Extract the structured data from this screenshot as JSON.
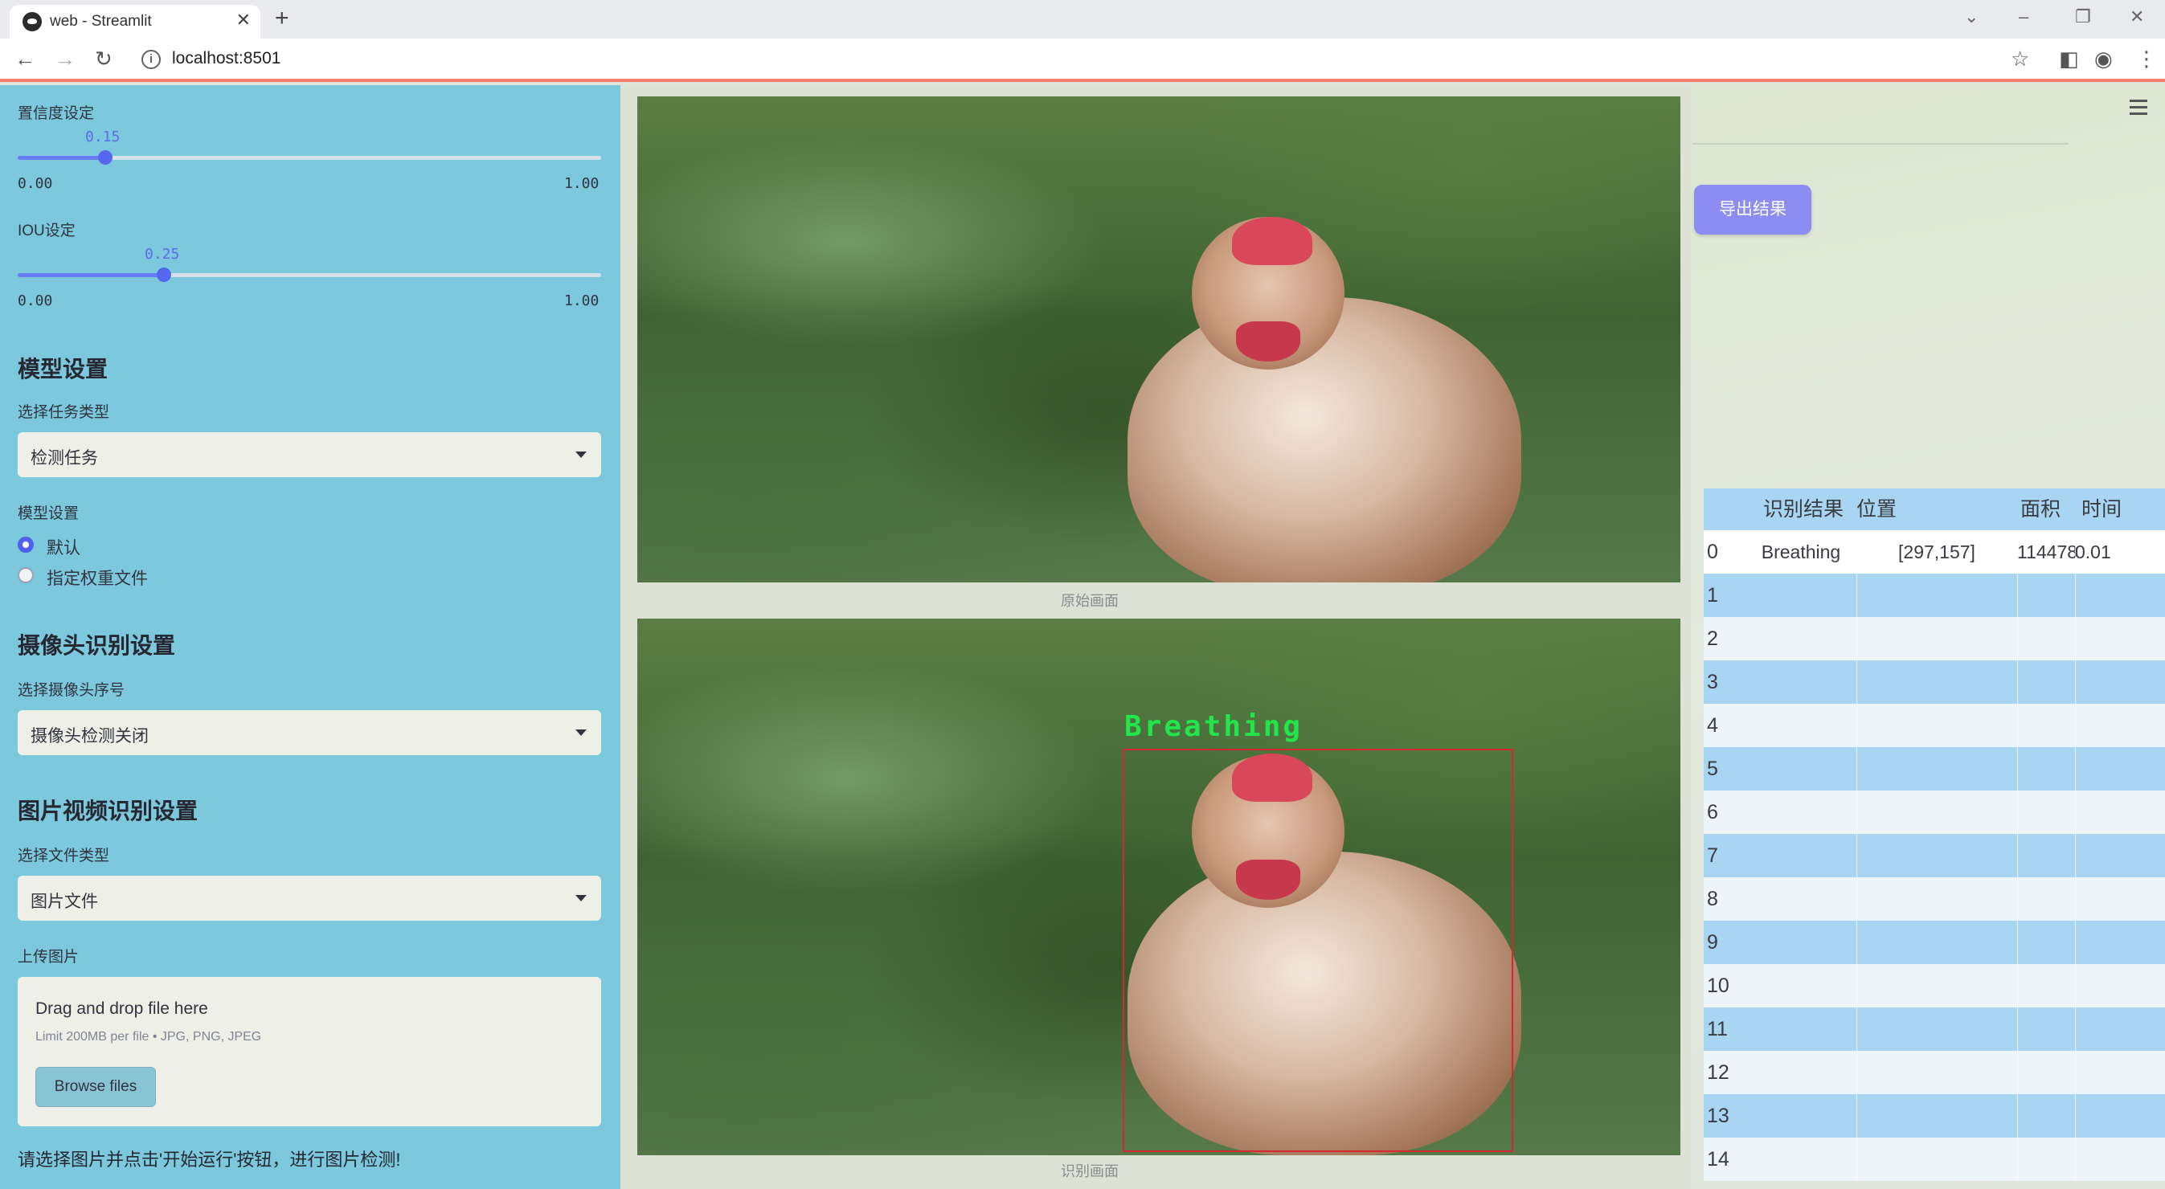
{
  "browser": {
    "tab_title": "web - Streamlit",
    "url": "localhost:8501"
  },
  "sidebar": {
    "conf_label": "置信度设定",
    "conf_value": 0.15,
    "conf_value_text": "0.15",
    "conf_min": "0.00",
    "conf_max": "1.00",
    "iou_label": "IOU设定",
    "iou_value": 0.25,
    "iou_value_text": "0.25",
    "iou_min": "0.00",
    "iou_max": "1.00",
    "model_header": "模型设置",
    "task_label": "选择任务类型",
    "task_value": "检测任务",
    "model_label": "模型设置",
    "model_options": [
      "默认",
      "指定权重文件"
    ],
    "model_selected": 0,
    "camera_header": "摄像头识别设置",
    "camera_label": "选择摄像头序号",
    "camera_value": "摄像头检测关闭",
    "media_header": "图片视频识别设置",
    "filetype_label": "选择文件类型",
    "filetype_value": "图片文件",
    "upload_label": "上传图片",
    "upload_drop": "Drag and drop file here",
    "upload_limit": "Limit 200MB per file • JPG, PNG, JPEG",
    "browse_button": "Browse files",
    "hint": "请选择图片并点击'开始运行'按钮，进行图片检测!"
  },
  "main": {
    "original_caption": "原始画面",
    "result_caption": "识别画面",
    "detection_label": "Breathing",
    "export_button": "导出结果"
  },
  "table": {
    "headers": [
      "",
      "识别结果",
      "位置",
      "面积",
      "时间"
    ],
    "rows": [
      [
        "0",
        "Breathing",
        "[297,157]",
        "114478",
        "0.01"
      ],
      [
        "1",
        "",
        "",
        "",
        ""
      ],
      [
        "2",
        "",
        "",
        "",
        ""
      ],
      [
        "3",
        "",
        "",
        "",
        ""
      ],
      [
        "4",
        "",
        "",
        "",
        ""
      ],
      [
        "5",
        "",
        "",
        "",
        ""
      ],
      [
        "6",
        "",
        "",
        "",
        ""
      ],
      [
        "7",
        "",
        "",
        "",
        ""
      ],
      [
        "8",
        "",
        "",
        "",
        ""
      ],
      [
        "9",
        "",
        "",
        "",
        ""
      ],
      [
        "10",
        "",
        "",
        "",
        ""
      ],
      [
        "11",
        "",
        "",
        "",
        ""
      ],
      [
        "12",
        "",
        "",
        "",
        ""
      ],
      [
        "13",
        "",
        "",
        "",
        ""
      ],
      [
        "14",
        "",
        "",
        "",
        ""
      ]
    ]
  },
  "colors": {
    "sidebar_bg": "#7cc8dc",
    "accent": "#5568f0",
    "export_button": "#8c8cf2",
    "detection_box": "#d4282e",
    "detection_text": "#22e54b"
  }
}
